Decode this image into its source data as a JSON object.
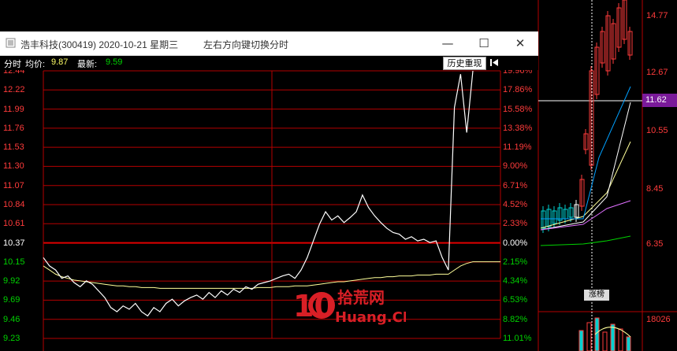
{
  "window": {
    "title": "浩丰科技(300419) 2020-10-21 星期三",
    "hint": "左右方向键切换分时",
    "controls": {
      "minimize": "—",
      "maximize": "☐",
      "close": "✕"
    }
  },
  "info": {
    "mode": "分时",
    "avg_label": "均价:",
    "avg_value": "9.87",
    "latest_label": "最新:",
    "latest_value": "9.59",
    "replay_button": "历史重现"
  },
  "colors": {
    "up": "#ff3b3b",
    "down": "#00d200",
    "price_line": "#ffffff",
    "avg_line": "#ffff9a",
    "grid": "#b50000",
    "tag_bg": "#7a1a9a"
  },
  "icons": [
    "app-icon",
    "rewind-icon"
  ],
  "daily": {
    "price_labels": [
      "14.77",
      "12.67",
      "10.55",
      "8.45",
      "6.35"
    ],
    "current_price_tag": "11.62",
    "rank_tag": "涨榜",
    "volume_labels": [
      "18026"
    ]
  },
  "watermark": {
    "text_top": "拾荒网",
    "text_bottom": "Huang.CN",
    "num": "10"
  },
  "chart_data": {
    "type": "line",
    "title": "",
    "prev_close": 10.37,
    "y_left_ticks": [
      "12.44",
      "12.22",
      "11.99",
      "11.76",
      "11.53",
      "11.30",
      "11.07",
      "10.84",
      "10.61",
      "10.37",
      "10.15",
      "9.92",
      "9.69",
      "9.46",
      "9.23"
    ],
    "y_right_ticks": [
      "19.96%",
      "17.86%",
      "15.58%",
      "13.38%",
      "11.19%",
      "9.00%",
      "6.71%",
      "4.52%",
      "2.33%",
      "0.00%",
      "2.15%",
      "4.34%",
      "6.53%",
      "8.82%",
      "11.01%"
    ],
    "ylim": [
      9.23,
      12.44
    ],
    "series": [
      {
        "name": "分时",
        "values": [
          10.2,
          10.1,
          10.05,
          9.95,
          9.98,
          9.9,
          9.85,
          9.92,
          9.88,
          9.8,
          9.72,
          9.6,
          9.55,
          9.62,
          9.58,
          9.65,
          9.55,
          9.5,
          9.6,
          9.55,
          9.65,
          9.7,
          9.62,
          9.68,
          9.72,
          9.75,
          9.7,
          9.78,
          9.72,
          9.8,
          9.75,
          9.82,
          9.78,
          9.85,
          9.82,
          9.88,
          9.9,
          9.92,
          9.95,
          9.98,
          10.0,
          9.95,
          10.05,
          10.2,
          10.4,
          10.6,
          10.75,
          10.65,
          10.7,
          10.62,
          10.68,
          10.75,
          10.95,
          10.8,
          10.7,
          10.62,
          10.55,
          10.5,
          10.48,
          10.42,
          10.45,
          10.4,
          10.42,
          10.38,
          10.4,
          10.2,
          10.05,
          12.0,
          12.4,
          11.7,
          12.44
        ]
      },
      {
        "name": "均价",
        "values": [
          10.1,
          10.05,
          10.0,
          9.97,
          9.95,
          9.93,
          9.92,
          9.91,
          9.9,
          9.89,
          9.88,
          9.87,
          9.86,
          9.86,
          9.85,
          9.85,
          9.84,
          9.84,
          9.84,
          9.83,
          9.83,
          9.83,
          9.83,
          9.83,
          9.83,
          9.83,
          9.83,
          9.83,
          9.83,
          9.83,
          9.83,
          9.83,
          9.83,
          9.83,
          9.83,
          9.84,
          9.84,
          9.84,
          9.85,
          9.85,
          9.85,
          9.86,
          9.86,
          9.86,
          9.87,
          9.88,
          9.89,
          9.9,
          9.91,
          9.91,
          9.92,
          9.93,
          9.94,
          9.95,
          9.96,
          9.96,
          9.97,
          9.97,
          9.98,
          9.98,
          9.98,
          9.99,
          9.99,
          9.99,
          10.0,
          10.0,
          10.0,
          10.05,
          10.1,
          10.13,
          10.15
        ]
      }
    ]
  }
}
